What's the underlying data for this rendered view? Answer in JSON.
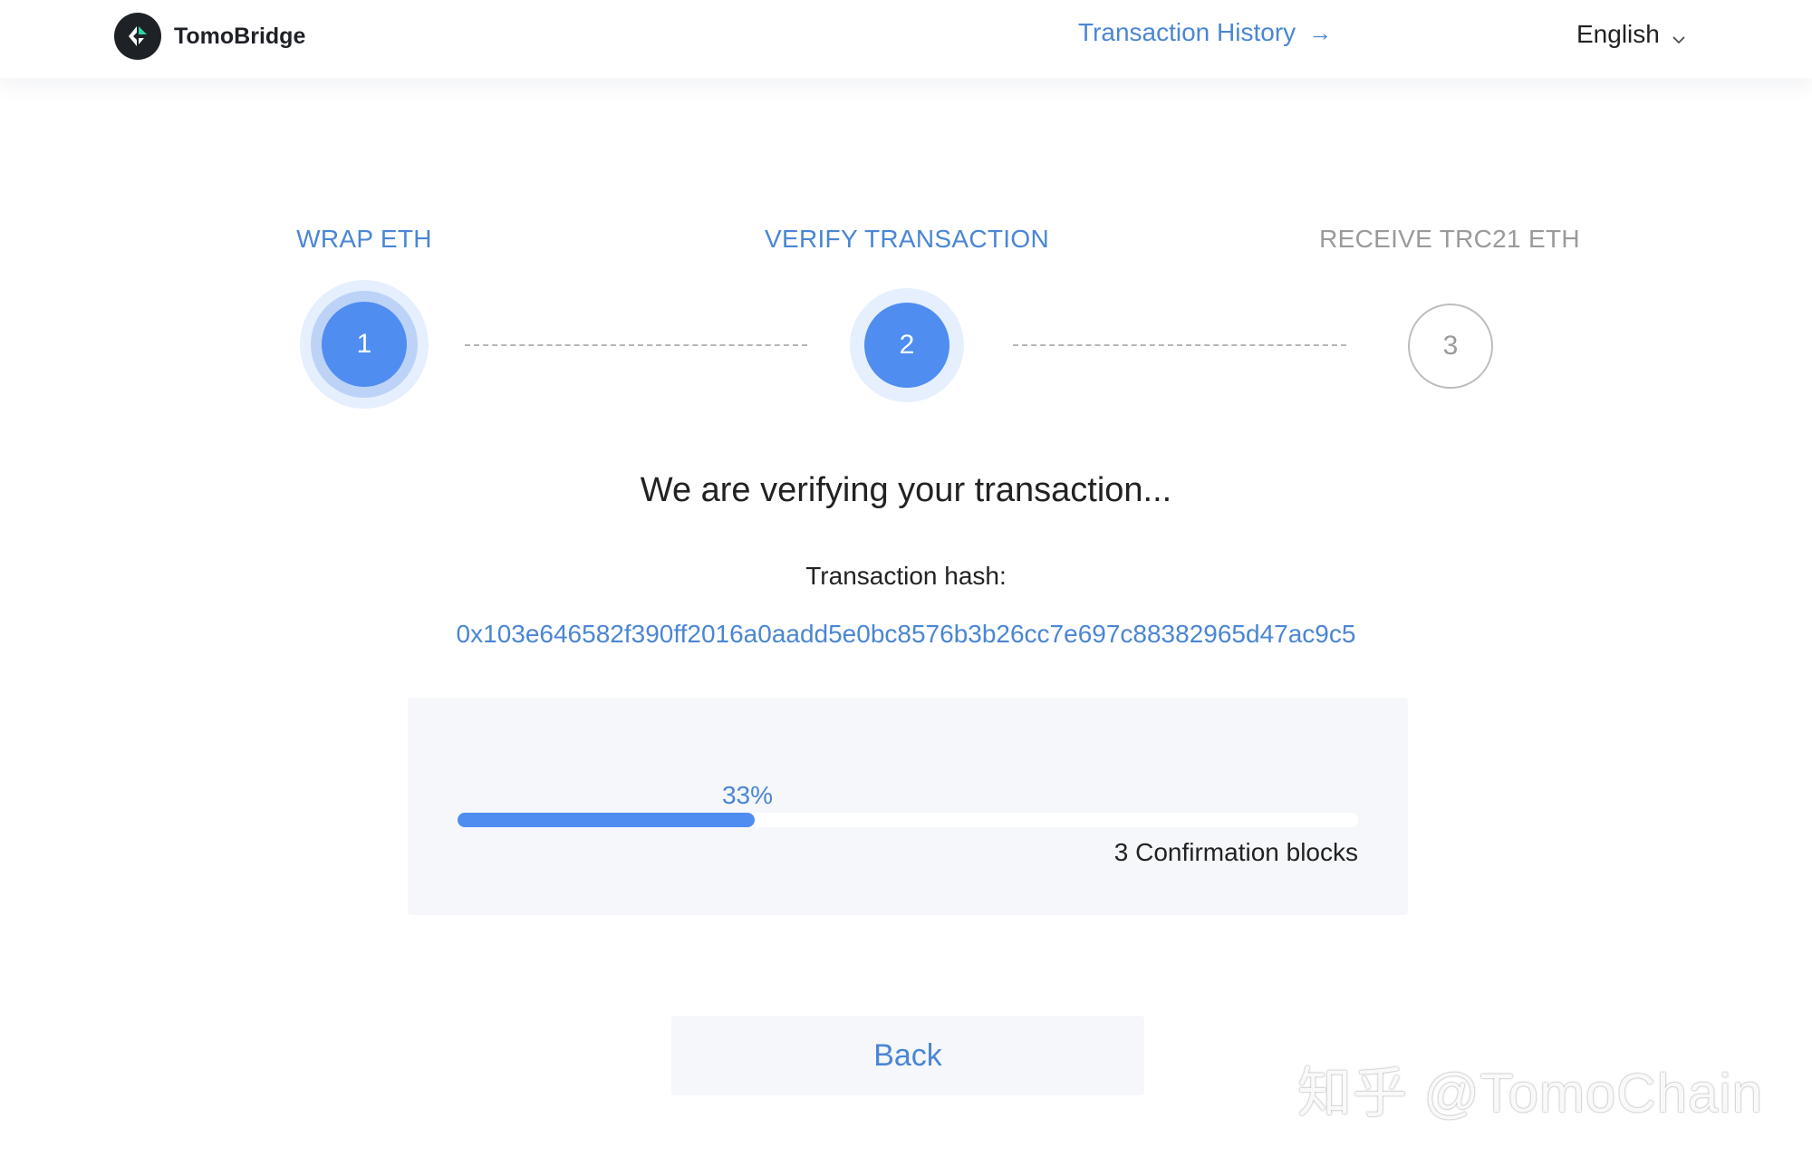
{
  "header": {
    "brand_name": "TomoBridge",
    "history_link": "Transaction History",
    "history_arrow": "→",
    "language": "English",
    "language_chevron": "v"
  },
  "steps": [
    {
      "label": "WRAP ETH",
      "number": "1",
      "state": "done"
    },
    {
      "label": "VERIFY TRANSACTION",
      "number": "2",
      "state": "current"
    },
    {
      "label": "RECEIVE TRC21 ETH",
      "number": "3",
      "state": "pending"
    }
  ],
  "main": {
    "heading": "We are verifying your transaction...",
    "hash_label": "Transaction hash:",
    "hash_value": "0x103e646582f390ff2016a0aadd5e0bc8576b3b26cc7e697c88382965d47ac9c5"
  },
  "progress": {
    "percent_label": "33%",
    "percent": 33,
    "caption": "3 Confirmation blocks"
  },
  "back_button_label": "Back",
  "watermark": "知乎 @TomoChain",
  "colors": {
    "accent": "#4f8df1",
    "link": "#4a86d4",
    "panel": "#f5f7fa",
    "inactive": "#9a9a9a"
  },
  "icons": {
    "logo": "tomochain-logo-icon",
    "history_arrow": "arrow-right-icon",
    "language_chevron": "chevron-down-icon"
  }
}
